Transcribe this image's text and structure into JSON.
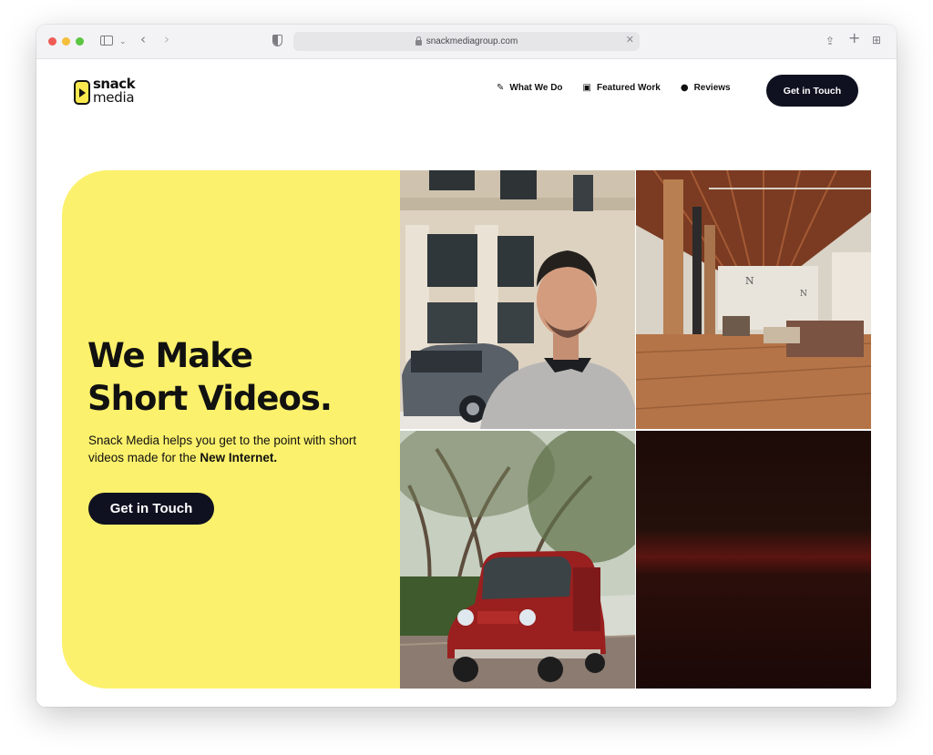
{
  "browser": {
    "url": "snackmediagroup.com"
  },
  "logo": {
    "line1": "snack",
    "line2": "media"
  },
  "nav": {
    "items": [
      {
        "label": "What We Do",
        "icon": "magic-wand-icon"
      },
      {
        "label": "Featured Work",
        "icon": "gallery-icon"
      },
      {
        "label": "Reviews",
        "icon": "chat-bubble-icon"
      }
    ],
    "cta_label": "Get in Touch"
  },
  "hero": {
    "title_line1": "We Make",
    "title_line2": "Short Videos.",
    "subtitle_plain": "Snack Media helps you get to the point with short videos made for the ",
    "subtitle_bold": "New Internet.",
    "cta_label": "Get in Touch"
  },
  "colors": {
    "accent_yellow": "#fcf16c",
    "button_dark": "#0f1120"
  }
}
